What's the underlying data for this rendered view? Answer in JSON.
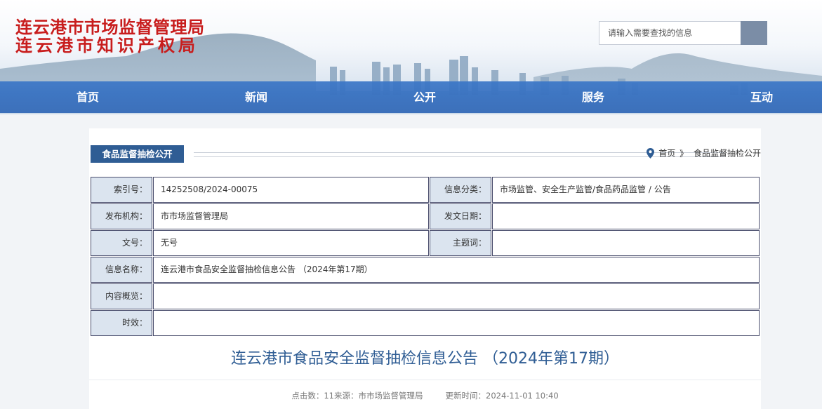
{
  "header": {
    "org_name_line1": "连云港市市场监督管理局",
    "org_name_line2": "连云港市知识产权局",
    "search_placeholder": "请输入需要查找的信息",
    "search_icon": "magnifier-icon"
  },
  "nav": {
    "items": [
      {
        "label": "首页"
      },
      {
        "label": "新闻"
      },
      {
        "label": "公开"
      },
      {
        "label": "服务"
      },
      {
        "label": "互动"
      }
    ]
  },
  "section": {
    "tab_label": "食品监督抽检公开",
    "breadcrumb_home": "首页",
    "breadcrumb_sep": "》",
    "breadcrumb_current": "食品监督抽检公开",
    "breadcrumb_icon": "location-pin-icon"
  },
  "meta": {
    "index_label": "索引号：",
    "index_value": "14252508/2024-00075",
    "category_label": "信息分类：",
    "category_value": "市场监管、安全生产监管/食品药品监管 / 公告",
    "publisher_label": "发布机构：",
    "publisher_value": "市市场监督管理局",
    "date_label": "发文日期：",
    "date_value": "",
    "docno_label": "文号：",
    "docno_value": "无号",
    "subject_label": "主题词：",
    "subject_value": "",
    "name_label": "信息名称：",
    "name_value": "连云港市食品安全监督抽检信息公告 （2024年第17期）",
    "summary_label": "内容概览：",
    "summary_value": "",
    "validity_label": "时效：",
    "validity_value": ""
  },
  "article": {
    "title": "连云港市食品安全监督抽检信息公告 （2024年第17期）",
    "clicks_label": "点击数：",
    "clicks_value": "11",
    "source_label": "来源：",
    "source_value": "市市场监督管理局",
    "updated_label": "更新时间：",
    "updated_value": "2024-11-01 10:40"
  },
  "colors": {
    "title_red": "#c81d1d",
    "nav_blue": "#3a76c7",
    "tab_blue": "#2f5d94",
    "label_bg": "#dbe4ef"
  }
}
